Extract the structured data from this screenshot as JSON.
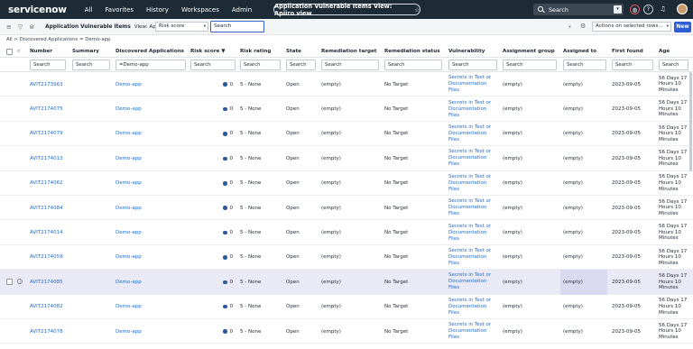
{
  "nav": {
    "logo": "servicenow",
    "links": [
      "All",
      "Favorites",
      "History",
      "Workspaces",
      "Admin"
    ],
    "pill_title": "Application Vulnerable Items View: Apiiro view",
    "pill_star": "☆",
    "search_placeholder": "Search",
    "search_dropdown_icon": "▾"
  },
  "toolbar": {
    "title": "Application Vulnerable Items",
    "view_label": "View: Apiiro view",
    "field_select": "Risk score",
    "search_value": "Search",
    "actions_select": "Actions on selected rows...",
    "new_button": "New",
    "caret": "▾"
  },
  "breadcrumb": "All > Discovered Applications = Demo-app",
  "columns": {
    "number": "Number",
    "summary": "Summary",
    "discovered_apps": "Discovered Applications",
    "risk_score": "Risk score ▼",
    "risk_rating": "Risk rating",
    "state": "State",
    "remediation_target": "Remediation target",
    "remediation_status": "Remediation status",
    "vulnerability": "Vulnerability",
    "assignment_group": "Assignment group",
    "assigned_to": "Assigned to",
    "first_found": "First found",
    "age": "Age"
  },
  "filters": {
    "number": "Search",
    "summary": "Search",
    "discovered_apps": "=Demo-app",
    "risk_score": "Search",
    "risk_rating": "Search",
    "state": "Search",
    "remediation_target": "Search",
    "remediation_status": "Search",
    "vulnerability": "Search",
    "assignment_group": "Search",
    "assigned_to": "Search",
    "first_found": "Search",
    "age": "Search"
  },
  "rows": [
    {
      "number": "AVIT2173963",
      "app": "Demo-app",
      "risk_score": "0",
      "risk_rating": "5 - None",
      "state": "Open",
      "rem_target": "(empty)",
      "rem_status": "No Target",
      "vulnerability": "Secrets in Test or Documentation Files",
      "group": "(empty)",
      "assigned": "(empty)",
      "first_found": "2023-09-05",
      "age": "56 Days 17 Hours 10 Minutes"
    },
    {
      "number": "AVIT2174075",
      "app": "Demo-app",
      "risk_score": "0",
      "risk_rating": "5 - None",
      "state": "Open",
      "rem_target": "(empty)",
      "rem_status": "No Target",
      "vulnerability": "Secrets in Test or Documentation Files",
      "group": "(empty)",
      "assigned": "(empty)",
      "first_found": "2023-09-05",
      "age": "56 Days 17 Hours 10 Minutes"
    },
    {
      "number": "AVIT2174079",
      "app": "Demo-app",
      "risk_score": "0",
      "risk_rating": "5 - None",
      "state": "Open",
      "rem_target": "(empty)",
      "rem_status": "No Target",
      "vulnerability": "Secrets in Test or Documentation Files",
      "group": "(empty)",
      "assigned": "(empty)",
      "first_found": "2023-09-05",
      "age": "56 Days 17 Hours 10 Minutes"
    },
    {
      "number": "AVIT2174013",
      "app": "Demo-app",
      "risk_score": "0",
      "risk_rating": "5 - None",
      "state": "Open",
      "rem_target": "(empty)",
      "rem_status": "No Target",
      "vulnerability": "Secrets in Test or Documentation Files",
      "group": "(empty)",
      "assigned": "(empty)",
      "first_found": "2023-09-05",
      "age": "56 Days 17 Hours 10 Minutes"
    },
    {
      "number": "AVIT2174062",
      "app": "Demo-app",
      "risk_score": "0",
      "risk_rating": "5 - None",
      "state": "Open",
      "rem_target": "(empty)",
      "rem_status": "No Target",
      "vulnerability": "Secrets in Test or Documentation Files",
      "group": "(empty)",
      "assigned": "(empty)",
      "first_found": "2023-09-05",
      "age": "56 Days 17 Hours 10 Minutes"
    },
    {
      "number": "AVIT2174084",
      "app": "Demo-app",
      "risk_score": "0",
      "risk_rating": "5 - None",
      "state": "Open",
      "rem_target": "(empty)",
      "rem_status": "No Target",
      "vulnerability": "Secrets in Test or Documentation Files",
      "group": "(empty)",
      "assigned": "(empty)",
      "first_found": "2023-09-05",
      "age": "56 Days 17 Hours 10 Minutes"
    },
    {
      "number": "AVIT2174014",
      "app": "Demo-app",
      "risk_score": "0",
      "risk_rating": "5 - None",
      "state": "Open",
      "rem_target": "(empty)",
      "rem_status": "No Target",
      "vulnerability": "Secrets in Test or Documentation Files",
      "group": "(empty)",
      "assigned": "(empty)",
      "first_found": "2023-09-05",
      "age": "56 Days 17 Hours 10 Minutes"
    },
    {
      "number": "AVIT2174059",
      "app": "Demo-app",
      "risk_score": "0",
      "risk_rating": "5 - None",
      "state": "Open",
      "rem_target": "(empty)",
      "rem_status": "No Target",
      "vulnerability": "Secrets in Test or Documentation Files",
      "group": "(empty)",
      "assigned": "(empty)",
      "first_found": "2023-09-05",
      "age": "56 Days 17 Hours 10 Minutes"
    },
    {
      "number": "AVIT2174085",
      "app": "Demo-app",
      "risk_score": "0",
      "risk_rating": "5 - None",
      "state": "Open",
      "rem_target": "(empty)",
      "rem_status": "No Target",
      "vulnerability": "Secrets in Test or Documentation Files",
      "group": "(empty)",
      "assigned": "(empty)",
      "first_found": "2023-09-05",
      "age": "56 Days 17 Hours 10 Minutes",
      "highlighted": true
    },
    {
      "number": "AVIT2174082",
      "app": "Demo-app",
      "risk_score": "0",
      "risk_rating": "5 - None",
      "state": "Open",
      "rem_target": "(empty)",
      "rem_status": "No Target",
      "vulnerability": "Secrets in Test or Documentation Files",
      "group": "(empty)",
      "assigned": "(empty)",
      "first_found": "2023-09-05",
      "age": "56 Days 17 Hours 10 Minutes"
    },
    {
      "number": "AVIT2174078",
      "app": "Demo-app",
      "risk_score": "0",
      "risk_rating": "5 - None",
      "state": "Open",
      "rem_target": "(empty)",
      "rem_status": "No Target",
      "vulnerability": "Secrets in Test or Documentation Files",
      "group": "(empty)",
      "assigned": "(empty)",
      "first_found": "2023-09-05",
      "age": "56 Days 17 Hours 10 Minutes"
    }
  ],
  "colors": {
    "nav_bg": "#1c2b36",
    "link": "#1a6dd4",
    "new_button": "#2e5cd6",
    "risk_dot": "#2c5aa0",
    "highlight_row": "#e9eaf5"
  }
}
